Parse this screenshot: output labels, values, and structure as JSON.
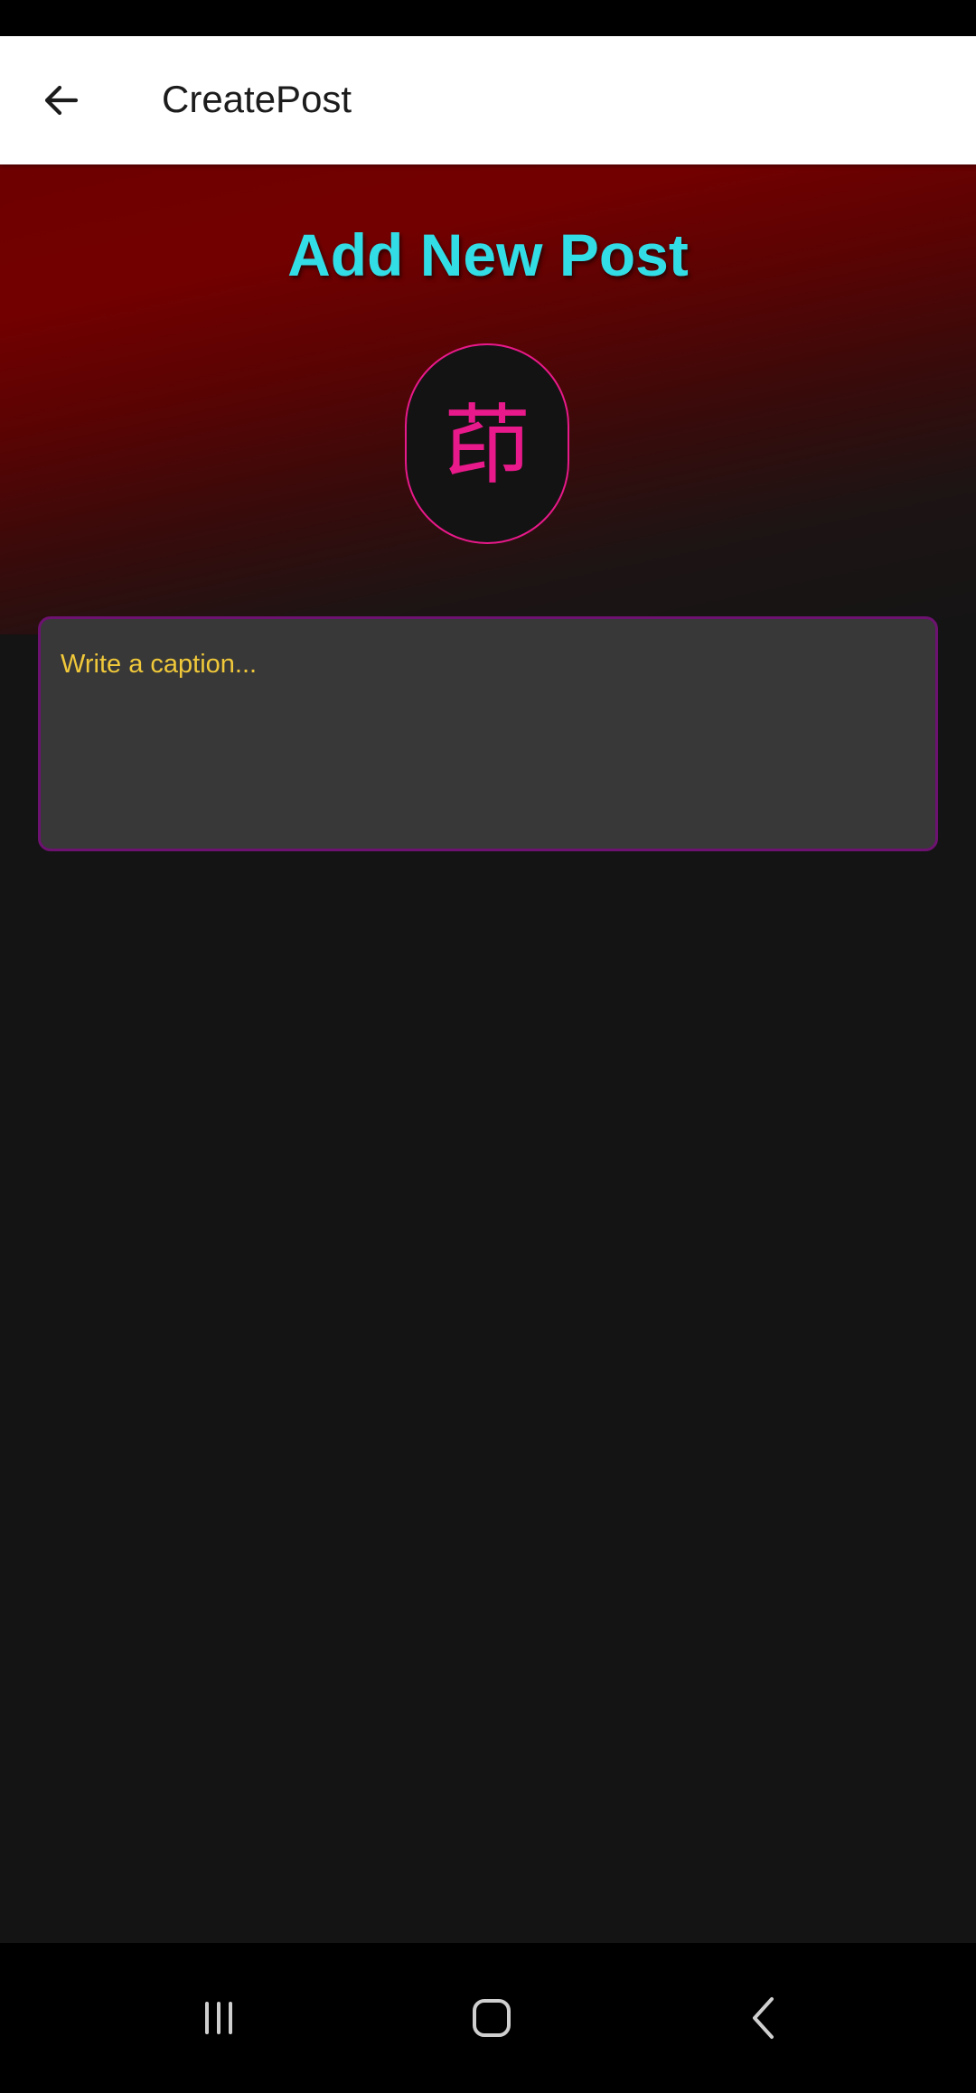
{
  "app_bar": {
    "title": "CreatePost",
    "back_icon": "arrow-left-icon"
  },
  "main": {
    "heading": "Add New Post",
    "avatar_glyph": "茚",
    "caption": {
      "value": "",
      "placeholder": "Write a caption..."
    }
  },
  "system_nav": {
    "recents_icon": "recent-apps-icon",
    "home_icon": "home-icon",
    "back_icon": "system-back-icon"
  },
  "colors": {
    "heading": "#33dde6",
    "accent_pink": "#e8198a",
    "caption_text": "#f0c83a",
    "caption_border": "#6d1270",
    "caption_bg": "#383838",
    "gradient_top": "#730000",
    "page_bg": "#141414"
  }
}
